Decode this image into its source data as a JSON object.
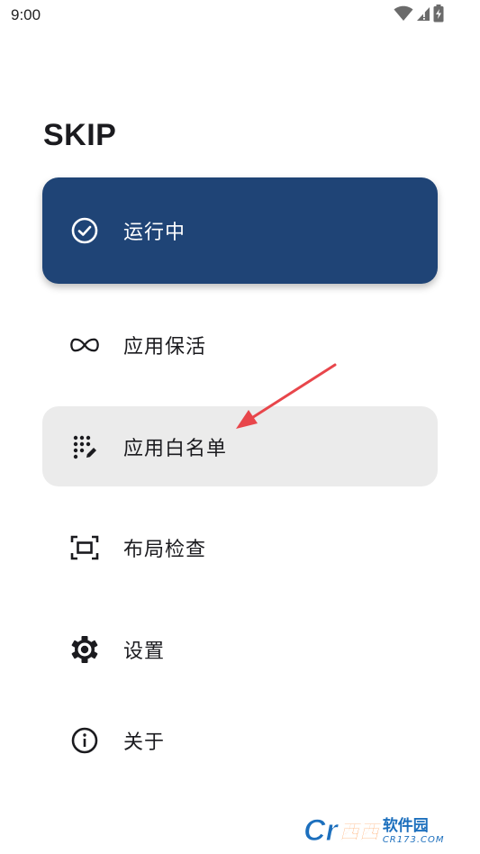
{
  "status_bar": {
    "time": "9:00",
    "icons": [
      "wifi-icon",
      "signal-icon",
      "battery-charging-icon"
    ]
  },
  "app": {
    "title": "SKIP"
  },
  "menu": {
    "items": [
      {
        "id": "running",
        "label": "运行中",
        "icon": "check-circle-icon",
        "active": true,
        "bg_color": "#1f4476",
        "fg_color": "#ffffff"
      },
      {
        "id": "keepalive",
        "label": "应用保活",
        "icon": "infinity-icon"
      },
      {
        "id": "whitelist",
        "label": "应用白名单",
        "icon": "dots-edit-icon",
        "highlighted": true,
        "bg_color": "#ebebeb"
      },
      {
        "id": "inspect",
        "label": "布局检查",
        "icon": "frame-select-icon"
      },
      {
        "id": "settings",
        "label": "设置",
        "icon": "gear-icon"
      },
      {
        "id": "about",
        "label": "关于",
        "icon": "info-icon"
      }
    ]
  },
  "annotation": {
    "arrow_color": "#e8464b"
  },
  "watermark": {
    "letters": "Cr",
    "xixi": "西西",
    "name": "软件园",
    "url": "CR173.COM"
  }
}
